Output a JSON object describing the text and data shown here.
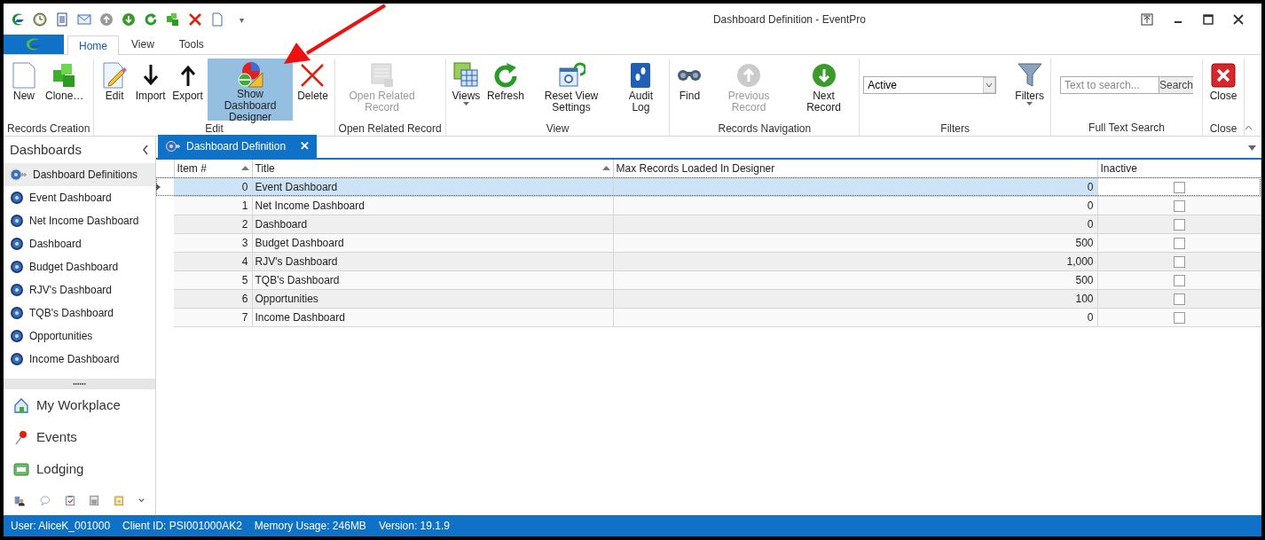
{
  "window": {
    "title": "Dashboard Definition - EventPro"
  },
  "quick_access_toolbar": {
    "overflow_glyph": "▾"
  },
  "ribbon_tabs": [
    {
      "label": "Home",
      "selected": true
    },
    {
      "label": "View",
      "selected": false
    },
    {
      "label": "Tools",
      "selected": false
    }
  ],
  "ribbon_groups": [
    {
      "label": "Records Creation",
      "buttons": [
        {
          "label": "New",
          "disabled": false,
          "selected": false,
          "has_menu": false
        },
        {
          "label": "Clone…",
          "disabled": false,
          "selected": false,
          "has_menu": false
        }
      ]
    },
    {
      "label": "Edit",
      "buttons": [
        {
          "label": "Edit",
          "disabled": false,
          "selected": false,
          "has_menu": false
        },
        {
          "label": "Import",
          "disabled": false,
          "selected": false,
          "has_menu": false
        },
        {
          "label": "Export",
          "disabled": false,
          "selected": false,
          "has_menu": false
        },
        {
          "label": "Show Dashboard Designer",
          "disabled": false,
          "selected": true,
          "has_menu": false
        },
        {
          "label": "Delete",
          "disabled": false,
          "selected": false,
          "has_menu": false
        }
      ]
    },
    {
      "label": "Open Related Record",
      "buttons": [
        {
          "label": "Open Related Record",
          "disabled": true,
          "selected": false,
          "has_menu": false
        }
      ]
    },
    {
      "label": "View",
      "buttons": [
        {
          "label": "Views",
          "disabled": false,
          "selected": false,
          "has_menu": true
        },
        {
          "label": "Refresh",
          "disabled": false,
          "selected": false,
          "has_menu": false
        },
        {
          "label": "Reset View Settings",
          "disabled": false,
          "selected": false,
          "has_menu": false
        },
        {
          "label": "Audit Log",
          "disabled": false,
          "selected": false,
          "has_menu": false
        }
      ]
    },
    {
      "label": "Records Navigation",
      "buttons": [
        {
          "label": "Find",
          "disabled": false,
          "selected": false,
          "has_menu": false
        },
        {
          "label": "Previous Record",
          "disabled": true,
          "selected": false,
          "has_menu": false
        },
        {
          "label": "Next Record",
          "disabled": false,
          "selected": false,
          "has_menu": false
        }
      ]
    },
    {
      "label": "Filters",
      "filter_value": "Active",
      "buttons": [
        {
          "label": "Filters",
          "disabled": false,
          "selected": false,
          "has_menu": true
        }
      ]
    },
    {
      "label": "Full Text Search",
      "search_placeholder": "Text to search...",
      "search_button": "Search"
    },
    {
      "label": "Close",
      "buttons": [
        {
          "label": "Close",
          "disabled": false,
          "selected": false,
          "has_menu": false
        }
      ]
    }
  ],
  "sidebar": {
    "title": "Dashboards",
    "items": [
      {
        "label": "Dashboard Definitions",
        "selected": true
      },
      {
        "label": "Event Dashboard",
        "selected": false
      },
      {
        "label": "Net Income Dashboard",
        "selected": false
      },
      {
        "label": "Dashboard",
        "selected": false
      },
      {
        "label": "Budget Dashboard",
        "selected": false
      },
      {
        "label": "RJV's Dashboard",
        "selected": false
      },
      {
        "label": "TQB's Dashboard",
        "selected": false
      },
      {
        "label": "Opportunities",
        "selected": false
      },
      {
        "label": "Income Dashboard",
        "selected": false
      }
    ],
    "splitter_glyph": "••••••",
    "nav_panes": [
      "My Workplace",
      "Events",
      "Lodging"
    ]
  },
  "document_tab": {
    "label": "Dashboard Definition",
    "close_glyph": "✕"
  },
  "table": {
    "columns": [
      "Item #",
      "Title",
      "Max Records Loaded In Designer",
      "Inactive"
    ],
    "rows": [
      {
        "item": "0",
        "title": "Event Dashboard",
        "max_records": "0",
        "inactive": false,
        "selected": true
      },
      {
        "item": "1",
        "title": "Net Income Dashboard",
        "max_records": "0",
        "inactive": false,
        "selected": false
      },
      {
        "item": "2",
        "title": "Dashboard",
        "max_records": "0",
        "inactive": false,
        "selected": false
      },
      {
        "item": "3",
        "title": "Budget Dashboard",
        "max_records": "500",
        "inactive": false,
        "selected": false
      },
      {
        "item": "4",
        "title": "RJV's Dashboard",
        "max_records": "1,000",
        "inactive": false,
        "selected": false
      },
      {
        "item": "5",
        "title": "TQB's Dashboard",
        "max_records": "500",
        "inactive": false,
        "selected": false
      },
      {
        "item": "6",
        "title": "Opportunities",
        "max_records": "100",
        "inactive": false,
        "selected": false
      },
      {
        "item": "7",
        "title": "Income Dashboard",
        "max_records": "0",
        "inactive": false,
        "selected": false
      }
    ]
  },
  "status_bar": [
    "User: AliceK_001000",
    "Client ID: PSI001000AK2",
    "Memory Usage: 246MB",
    "Version: 19.1.9"
  ]
}
